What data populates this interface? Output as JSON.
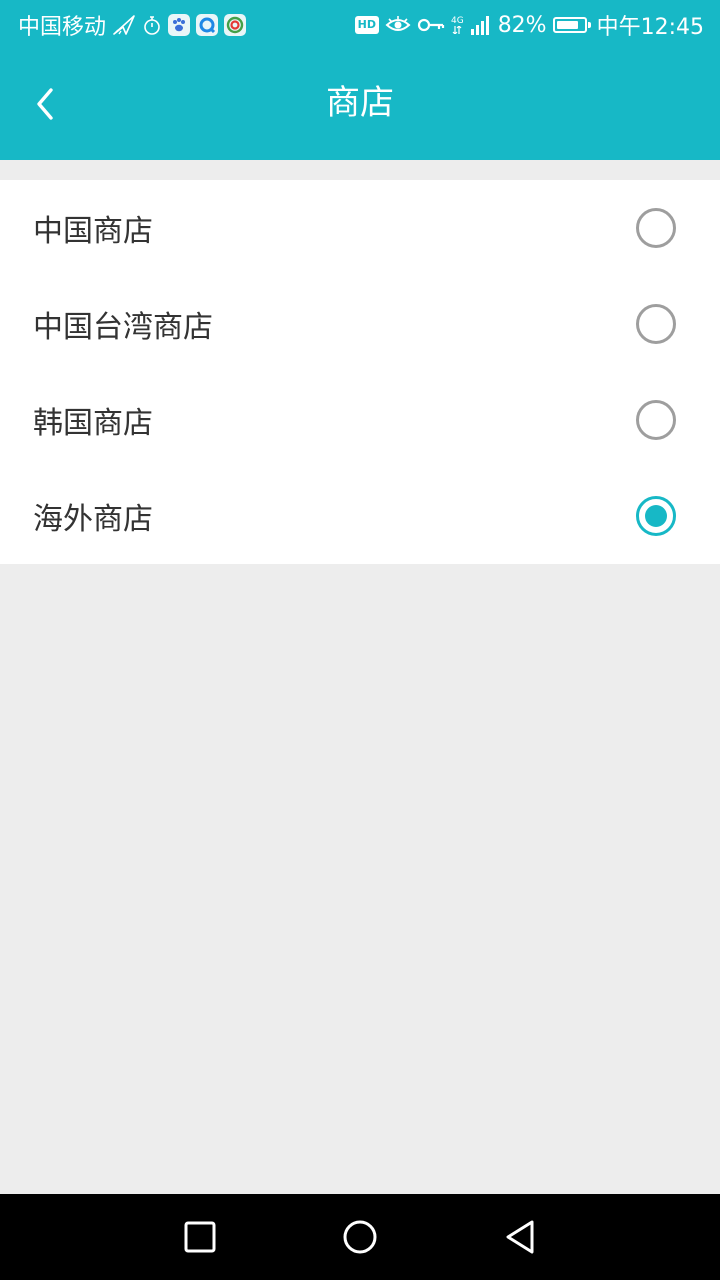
{
  "status_bar": {
    "carrier": "中国移动",
    "hd_label": "HD",
    "network_type": "4G",
    "battery_percent": "82%",
    "battery_level": 0.82,
    "time": "中午12:45"
  },
  "header": {
    "title": "商店",
    "back_icon": "chevron-left-icon"
  },
  "store_options": [
    {
      "label": "中国商店",
      "selected": false
    },
    {
      "label": "中国台湾商店",
      "selected": false
    },
    {
      "label": "韩国商店",
      "selected": false
    },
    {
      "label": "海外商店",
      "selected": true
    }
  ],
  "nav_bar": {
    "recents_icon": "square-icon",
    "home_icon": "circle-icon",
    "back_icon": "triangle-back-icon"
  },
  "colors": {
    "accent": "#17b8c6",
    "background": "#ededed",
    "radio_unchecked": "#9e9e9e",
    "text_primary": "#333333"
  }
}
